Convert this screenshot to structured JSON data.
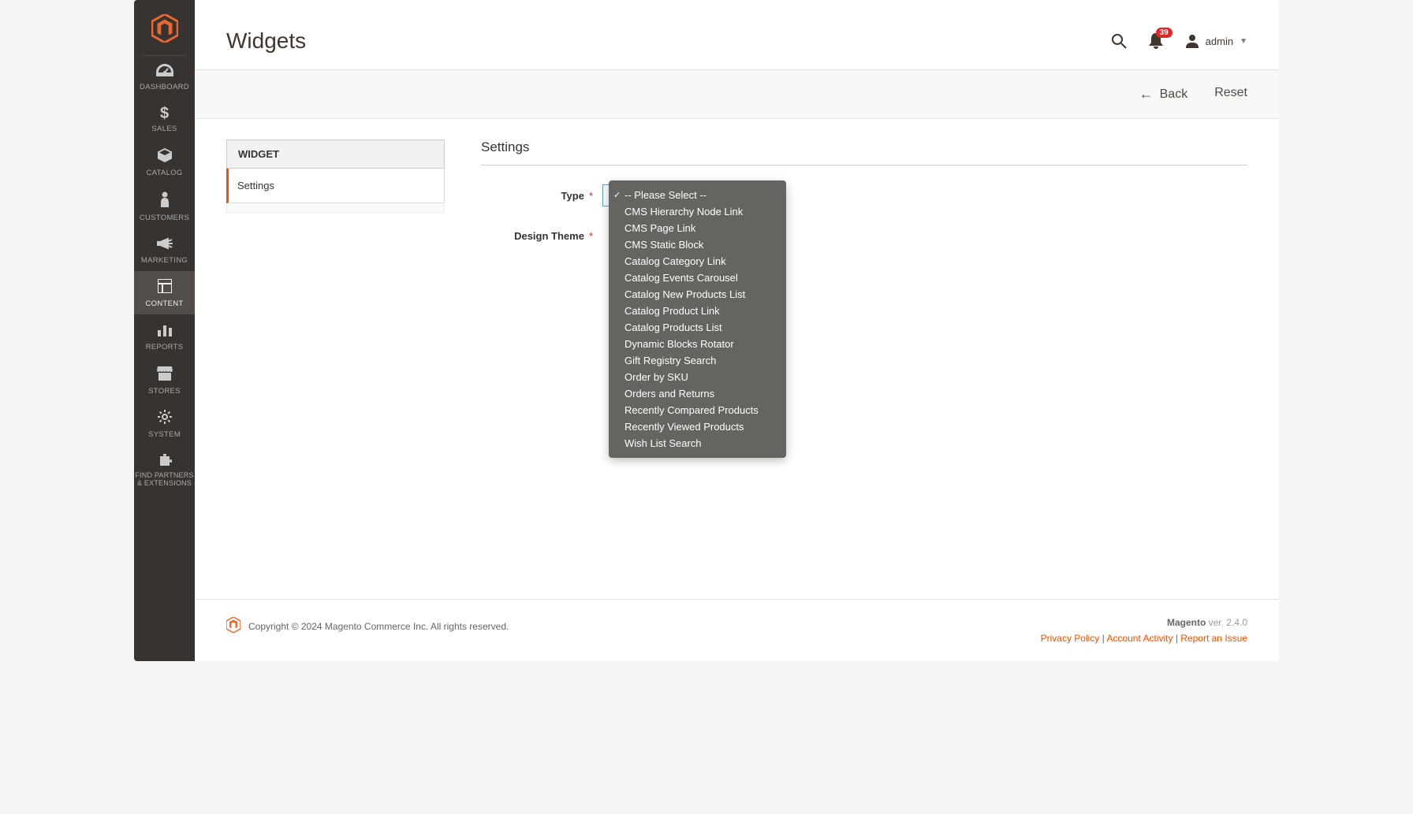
{
  "sidebar": {
    "items": [
      {
        "label": "DASHBOARD"
      },
      {
        "label": "SALES"
      },
      {
        "label": "CATALOG"
      },
      {
        "label": "CUSTOMERS"
      },
      {
        "label": "MARKETING"
      },
      {
        "label": "CONTENT"
      },
      {
        "label": "REPORTS"
      },
      {
        "label": "STORES"
      },
      {
        "label": "SYSTEM"
      },
      {
        "label1": "FIND PARTNERS",
        "label2": "& EXTENSIONS"
      }
    ]
  },
  "header": {
    "title": "Widgets",
    "badge": "39",
    "user": "admin"
  },
  "actions": {
    "back": "Back",
    "reset": "Reset"
  },
  "panel": {
    "tabs_title": "WIDGET",
    "settings_item": "Settings"
  },
  "form": {
    "section_title": "Settings",
    "type_label": "Type",
    "design_theme_label": "Design Theme",
    "type_options": [
      "-- Please Select --",
      "CMS Hierarchy Node Link",
      "CMS Page Link",
      "CMS Static Block",
      "Catalog Category Link",
      "Catalog Events Carousel",
      "Catalog New Products List",
      "Catalog Product Link",
      "Catalog Products List",
      "Dynamic Blocks Rotator",
      "Gift Registry Search",
      "Order by SKU",
      "Orders and Returns",
      "Recently Compared Products",
      "Recently Viewed Products",
      "Wish List Search"
    ],
    "selected_index": 0
  },
  "footer": {
    "copyright": "Copyright © 2024 Magento Commerce Inc. All rights reserved.",
    "brand": "Magento",
    "version": " ver. 2.4.0",
    "privacy": "Privacy Policy",
    "activity": "Account Activity",
    "report": "Report an Issue"
  }
}
